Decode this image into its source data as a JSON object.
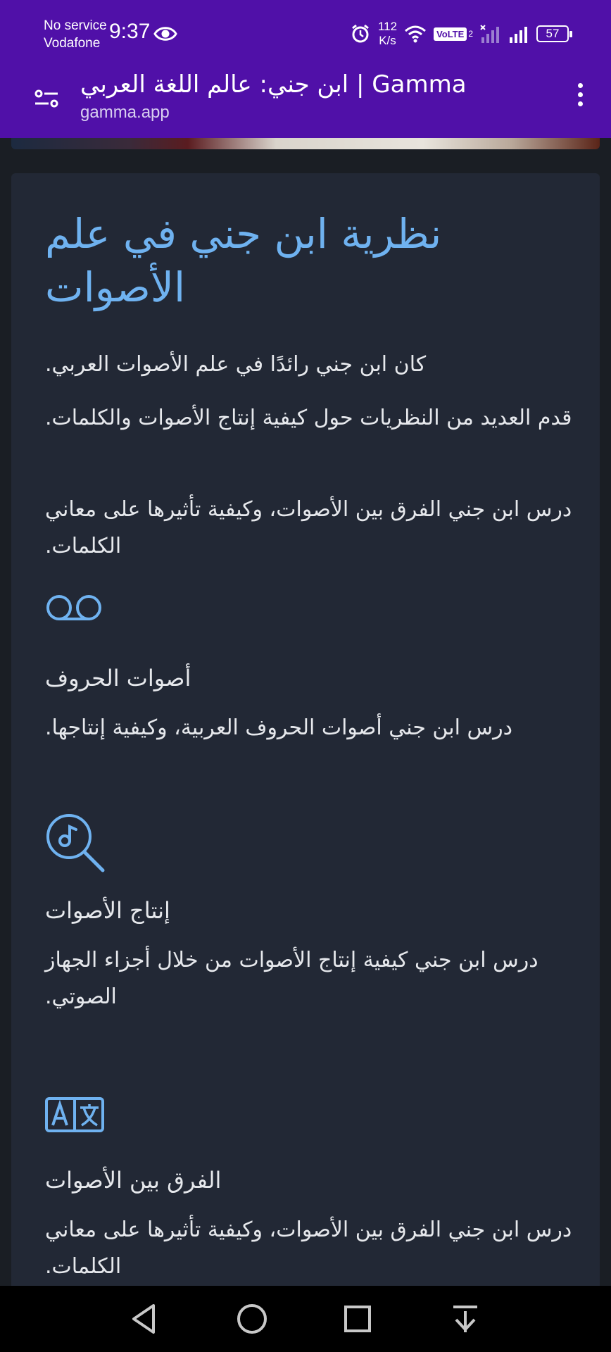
{
  "status_bar": {
    "carrier_line1": "No service",
    "carrier_line2": "Vodafone",
    "time": "9:37",
    "speed_value": "112",
    "speed_unit": "K/s",
    "volte": "VoLTE",
    "sim_index": "2",
    "battery": "57"
  },
  "app_bar": {
    "title": "ابن جني: عالم اللغة العربي | Gamma",
    "url": "gamma.app"
  },
  "main": {
    "heading": "نظرية ابن جني في علم الأصوات",
    "paragraphs": [
      "كان ابن جني رائدًا في علم الأصوات العربي.",
      "قدم العديد من النظريات حول كيفية إنتاج الأصوات والكلمات.",
      "درس ابن جني الفرق بين الأصوات، وكيفية تأثيرها على معاني الكلمات."
    ],
    "features": [
      {
        "icon": "voicemail-icon",
        "title": "أصوات الحروف",
        "text": "درس ابن جني أصوات الحروف العربية، وكيفية إنتاجها."
      },
      {
        "icon": "music-search-icon",
        "title": "إنتاج الأصوات",
        "text": "درس ابن جني كيفية إنتاج الأصوات من خلال أجزاء الجهاز الصوتي."
      },
      {
        "icon": "translate-icon",
        "title": "الفرق بين الأصوات",
        "text": "درس ابن جني الفرق بين الأصوات، وكيفية تأثيرها على معاني الكلمات."
      }
    ]
  },
  "colors": {
    "status_bar": "#5010a8",
    "page_background": "#1a1e24",
    "card_background": "#222835",
    "heading": "#6fb2f0",
    "icon_accent": "#6fb2f0"
  },
  "nav_bar": {
    "buttons": [
      "back-icon",
      "home-icon",
      "recents-icon",
      "download-icon"
    ]
  }
}
